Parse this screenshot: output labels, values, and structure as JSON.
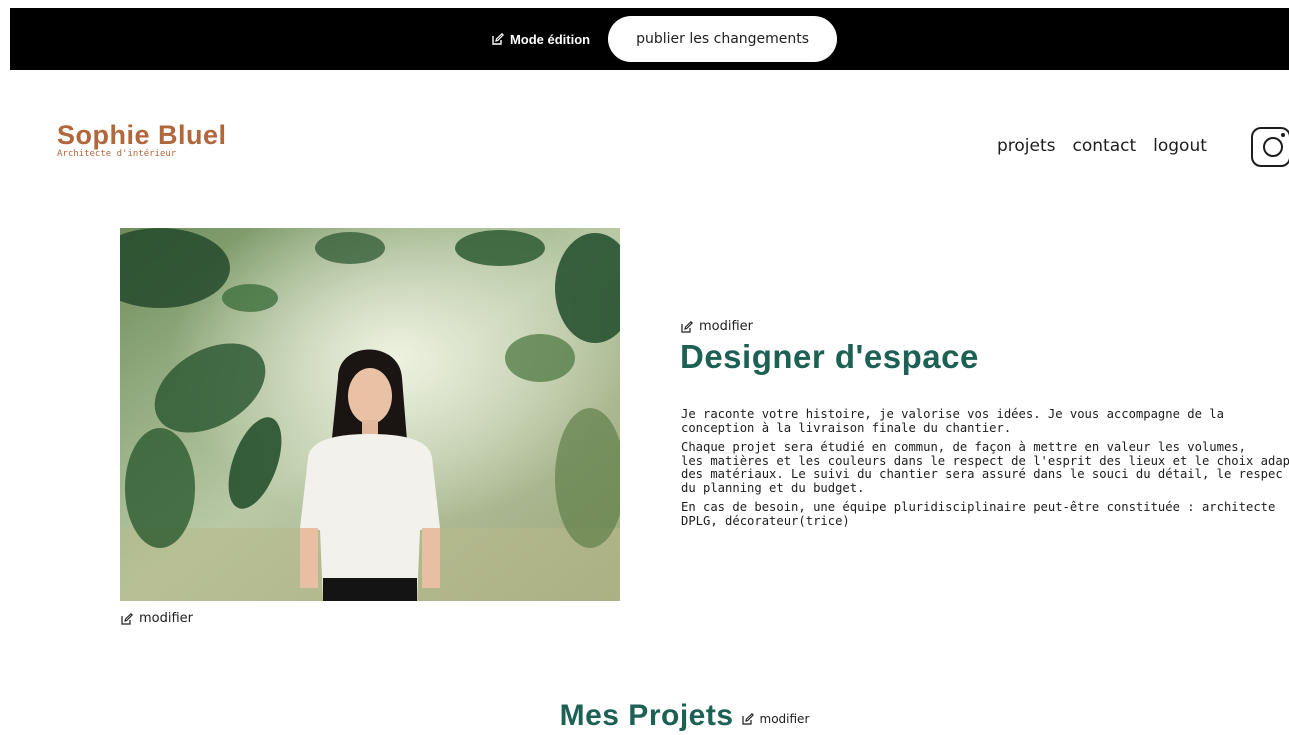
{
  "edit_bar": {
    "mode_label": "Mode édition",
    "publish_label": "publier les changements"
  },
  "header": {
    "logo_name": "Sophie Bluel",
    "logo_subtitle": "Architecte d'intérieur",
    "nav": [
      "projets",
      "contact",
      "logout"
    ],
    "instagram_icon": "instagram-icon"
  },
  "photo": {
    "modify_label": "modifier"
  },
  "intro": {
    "modify_label": "modifier",
    "title": "Designer d'espace",
    "paragraphs": [
      [
        "Je raconte votre histoire, je valorise vos idées. Je vous accompagne de la",
        "conception à la livraison finale du chantier."
      ],
      [
        "Chaque projet sera étudié en commun, de façon à mettre en valeur les volumes,",
        "les matières et les couleurs dans le respect de l'esprit des lieux et le choix adap",
        "des matériaux. Le suivi du chantier sera assuré dans le souci du détail, le respec",
        "du planning et du budget."
      ],
      [
        "En cas de besoin, une équipe pluridisciplinaire peut-être constituée : architecte",
        "DPLG, décorateur(trice)"
      ]
    ]
  },
  "projects": {
    "title": "Mes Projets",
    "modify_label": "modifier"
  },
  "colors": {
    "brand": "#b1663c",
    "accent": "#1d6154",
    "banner": "#000000"
  }
}
